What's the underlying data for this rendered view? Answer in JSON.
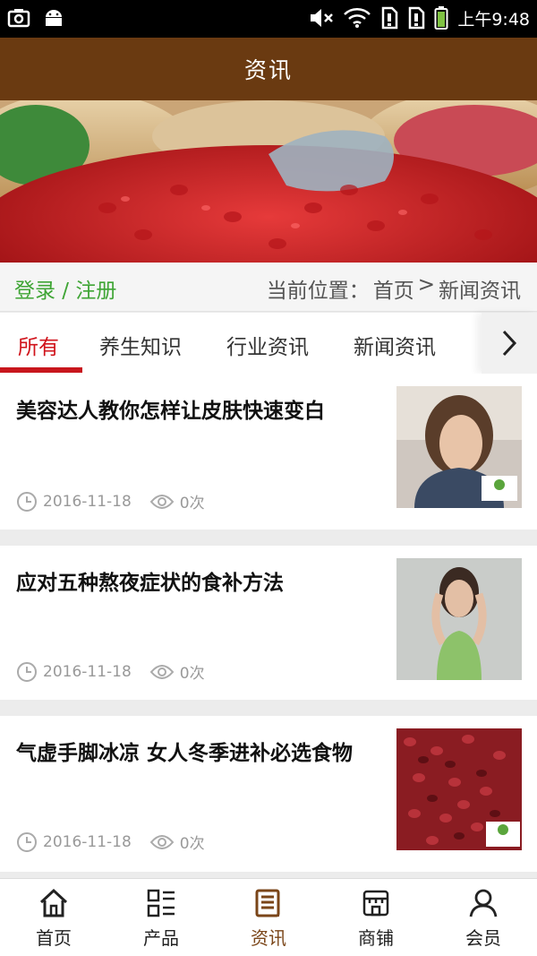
{
  "status_bar": {
    "time": "上午9:48"
  },
  "header": {
    "title": "资讯"
  },
  "crumb": {
    "login": "登录 / 注册",
    "label": "当前位置：",
    "home": "首页",
    "sep": ">",
    "current": "新闻资讯"
  },
  "tabs": [
    {
      "label": "所有",
      "active": true
    },
    {
      "label": "养生知识",
      "active": false
    },
    {
      "label": "行业资讯",
      "active": false
    },
    {
      "label": "新闻资讯",
      "active": false
    }
  ],
  "articles": [
    {
      "title": "美容达人教你怎样让皮肤快速变白",
      "date": "2016-11-18",
      "views": "0次"
    },
    {
      "title": "应对五种熬夜症状的食补方法",
      "date": "2016-11-18",
      "views": "0次"
    },
    {
      "title": "气虚手脚冰凉 女人冬季进补必选食物",
      "date": "2016-11-18",
      "views": "0次"
    }
  ],
  "bottom_nav": [
    {
      "label": "首页",
      "icon": "home-icon",
      "active": false
    },
    {
      "label": "产品",
      "icon": "grid-list-icon",
      "active": false
    },
    {
      "label": "资讯",
      "icon": "document-icon",
      "active": true
    },
    {
      "label": "商铺",
      "icon": "store-icon",
      "active": false
    },
    {
      "label": "会员",
      "icon": "user-icon",
      "active": false
    }
  ],
  "colors": {
    "header": "#6a3a11",
    "accent": "#c8161d",
    "login": "#3fa535",
    "nav_active": "#7a4518"
  }
}
